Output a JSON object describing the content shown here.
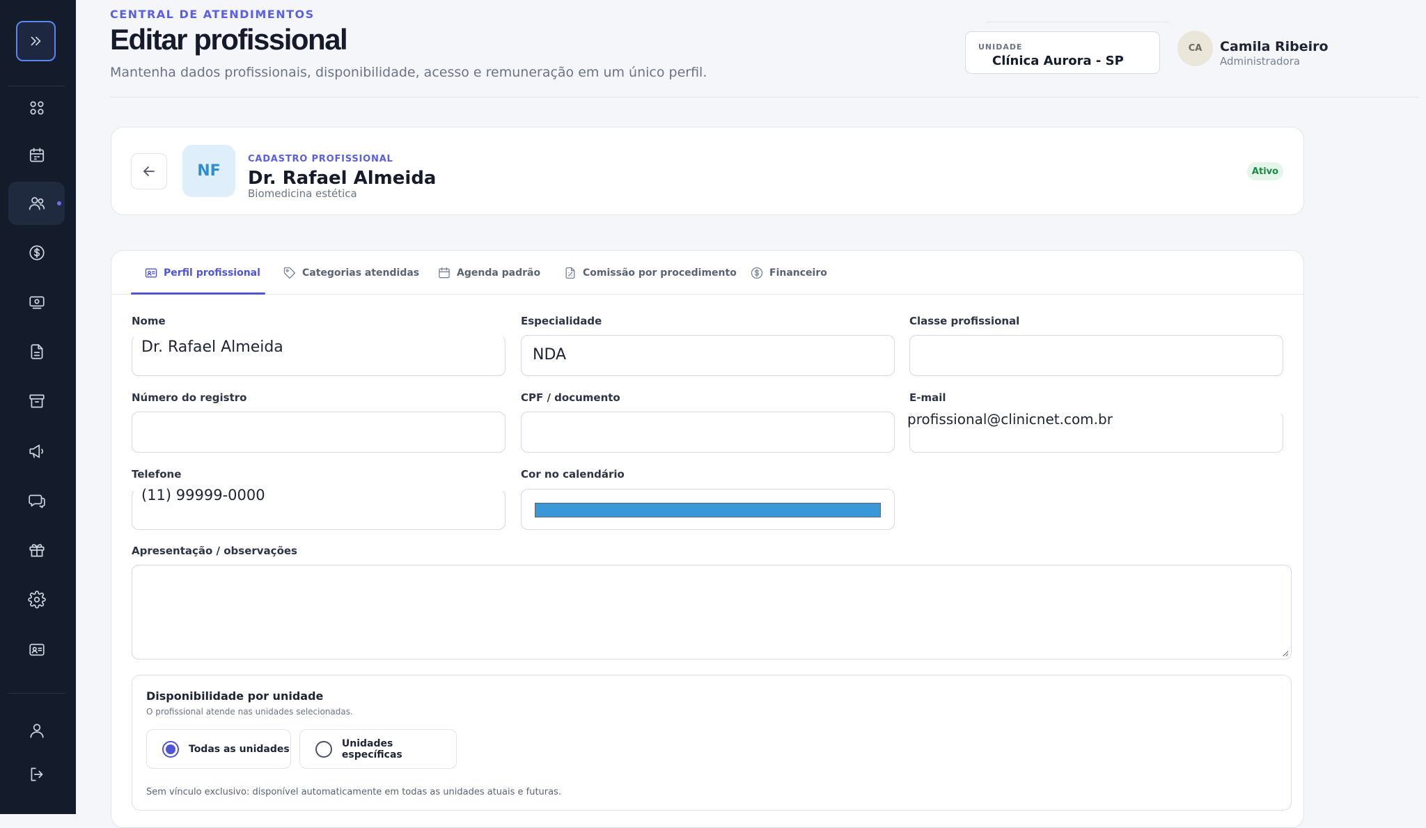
{
  "sidebar": {
    "toggle_icon": "chevrons-right-icon",
    "items": [
      {
        "name": "dashboard",
        "icon": "grid-icon"
      },
      {
        "name": "agenda",
        "icon": "calendar-icon"
      },
      {
        "name": "profissionais",
        "icon": "users-icon",
        "active": true
      },
      {
        "name": "financeiro",
        "icon": "dollar-circle-icon"
      },
      {
        "name": "caixa",
        "icon": "cash-monitor-icon"
      },
      {
        "name": "documentos",
        "icon": "document-icon"
      },
      {
        "name": "estoque",
        "icon": "archive-icon"
      },
      {
        "name": "marketing",
        "icon": "megaphone-icon"
      },
      {
        "name": "mensagens",
        "icon": "chat-icon"
      },
      {
        "name": "fidelidade",
        "icon": "gift-icon"
      },
      {
        "name": "configuracoes",
        "icon": "gear-icon"
      },
      {
        "name": "cadastros",
        "icon": "id-card-icon"
      }
    ],
    "bottom": [
      {
        "name": "perfil",
        "icon": "user-icon"
      },
      {
        "name": "sair",
        "icon": "logout-icon"
      }
    ]
  },
  "header": {
    "eyebrow": "CENTRAL DE ATENDIMENTOS",
    "title": "Editar profissional",
    "subtitle": "Mantenha dados profissionais, disponibilidade, acesso e remuneração em um único perfil.",
    "unit_label": "UNIDADE",
    "unit_value": "Clínica Aurora - SP",
    "user_initials": "CA",
    "user_name": "Camila Ribeiro",
    "user_role": "Administradora"
  },
  "profile": {
    "initials": "NF",
    "section_label": "CADASTRO PROFISSIONAL",
    "name": "Dr. Rafael Almeida",
    "specialty": "Biomedicina estética",
    "status": "Ativo"
  },
  "tabs": [
    {
      "label": "Perfil profissional",
      "icon": "id-card-icon",
      "active": true
    },
    {
      "label": "Categorias atendidas",
      "icon": "tag-icon"
    },
    {
      "label": "Agenda padrão",
      "icon": "calendar-icon"
    },
    {
      "label": "Comissão por procedimento",
      "icon": "percent-document-icon"
    },
    {
      "label": "Financeiro",
      "icon": "dollar-circle-icon"
    }
  ],
  "form": {
    "nome_label": "Nome",
    "nome_value": "Dr. Rafael Almeida",
    "especialidade_label": "Especialidade",
    "especialidade_value": "NDA",
    "classe_label": "Classe profissional",
    "classe_value": "",
    "registro_label": "Número do registro",
    "registro_value": "",
    "cpf_label": "CPF / documento",
    "cpf_value": "",
    "email_label": "E-mail",
    "email_value": "profissional@clinicnet.com.br",
    "telefone_label": "Telefone",
    "telefone_value": "(11) 99999-0000",
    "cor_label": "Cor no calendário",
    "cor_value": "#3a97d8",
    "apresentacao_label": "Apresentação / observações",
    "apresentacao_value": ""
  },
  "availability": {
    "title": "Disponibilidade por unidade",
    "subtitle": "O profissional atende nas unidades selecionadas.",
    "options": [
      {
        "label": "Todas as unidades",
        "selected": true
      },
      {
        "label": "Unidades específicas",
        "selected": false
      }
    ],
    "note": "Sem vínculo exclusivo: disponível automaticamente em todas as unidades atuais e futuras."
  },
  "colors": {
    "sidebar_bg": "#141b2b",
    "accent": "#5054d6",
    "status_green": "#168a44",
    "calendar_color": "#3a97d8"
  }
}
